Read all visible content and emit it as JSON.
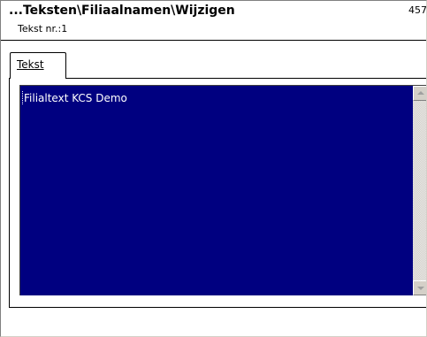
{
  "header": {
    "title": "...Teksten\\Filiaalnamen\\Wijzigen",
    "subtitle": "Tekst nr.:1",
    "corner_number": "457"
  },
  "tabs": [
    {
      "label": "Tekst",
      "selected": true
    }
  ],
  "editor": {
    "value": "Filialtext KCS Demo",
    "background_color": "#000080",
    "text_color": "#ffffff"
  },
  "scrollbar": {
    "up_icon": "arrow-up-icon",
    "down_icon": "arrow-down-icon"
  }
}
